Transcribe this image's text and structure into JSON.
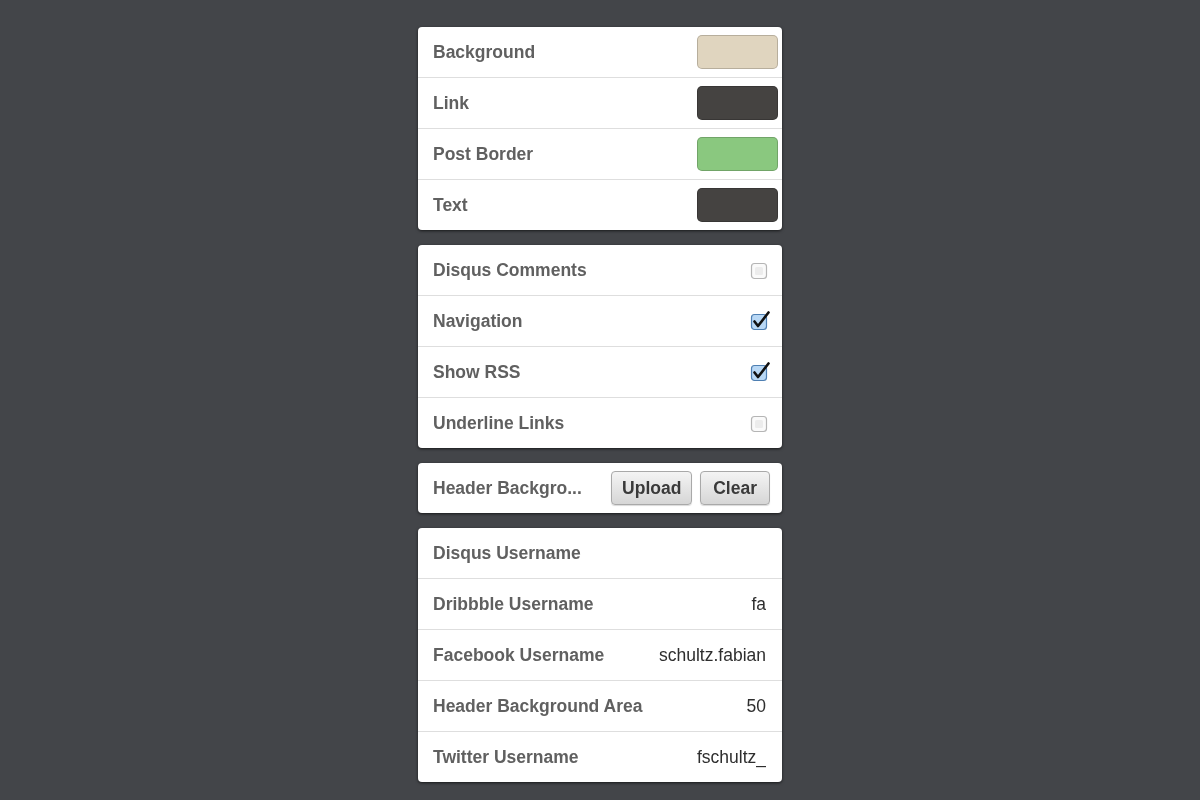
{
  "color_settings": [
    {
      "label": "Background",
      "color": "#e0d5bf"
    },
    {
      "label": "Link",
      "color": "#454341"
    },
    {
      "label": "Post Border",
      "color": "#8ac87f"
    },
    {
      "label": "Text",
      "color": "#454341"
    }
  ],
  "toggle_settings": [
    {
      "label": "Disqus Comments",
      "checked": false
    },
    {
      "label": "Navigation",
      "checked": true
    },
    {
      "label": "Show RSS",
      "checked": true
    },
    {
      "label": "Underline Links",
      "checked": false
    }
  ],
  "image_setting": {
    "label": "Header Backgro...",
    "buttons": [
      "Upload",
      "Clear"
    ]
  },
  "text_settings": [
    {
      "label": "Disqus Username"
    },
    {
      "label": "Dribbble Username",
      "value": "fa"
    },
    {
      "label": "Facebook Username",
      "value": "schultz.fabian"
    },
    {
      "label": "Header Background Area",
      "value": "50"
    },
    {
      "label": "Twitter Username",
      "value": "fschultz_"
    }
  ]
}
